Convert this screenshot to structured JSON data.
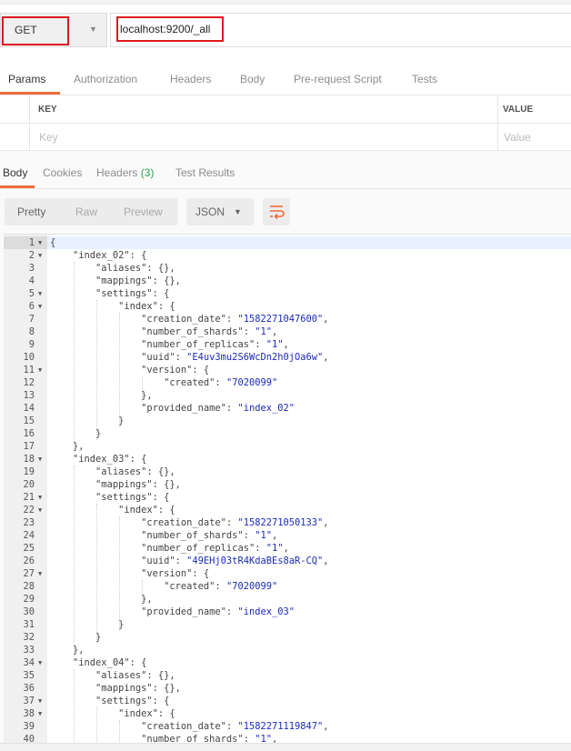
{
  "request": {
    "method": "GET",
    "url": "localhost:9200/_all"
  },
  "request_tabs": [
    "Params",
    "Authorization",
    "Headers",
    "Body",
    "Pre-request Script",
    "Tests"
  ],
  "params_table": {
    "key_header": "KEY",
    "value_header": "VALUE",
    "key_placeholder": "Key",
    "value_placeholder": "Value"
  },
  "response_tabs": {
    "body": "Body",
    "cookies": "Cookies",
    "headers": "Headers",
    "headers_count": "(3)",
    "test_results": "Test Results"
  },
  "toolbar": {
    "pretty": "Pretty",
    "raw": "Raw",
    "preview": "Preview",
    "format": "JSON"
  },
  "colors": {
    "accent": "#f26b3a",
    "highlight_box": "#e0191f",
    "json_string": "#1c2bb8",
    "headers_count": "#2ea44f"
  },
  "icons": {
    "method_dropdown": "chevron-down-icon",
    "format_dropdown": "chevron-down-icon",
    "wrap": "wrap-lines-icon",
    "fold": "fold-arrow-icon"
  },
  "code_lines": [
    {
      "n": "1",
      "fold": true,
      "text": "{"
    },
    {
      "n": "2",
      "fold": true,
      "text": "    \"index_02\": {"
    },
    {
      "n": "3",
      "fold": false,
      "text": "        \"aliases\": {},"
    },
    {
      "n": "4",
      "fold": false,
      "text": "        \"mappings\": {},"
    },
    {
      "n": "5",
      "fold": true,
      "text": "        \"settings\": {"
    },
    {
      "n": "6",
      "fold": true,
      "text": "            \"index\": {"
    },
    {
      "n": "7",
      "fold": false,
      "text": "                \"creation_date\": \"1582271047600\","
    },
    {
      "n": "8",
      "fold": false,
      "text": "                \"number_of_shards\": \"1\","
    },
    {
      "n": "9",
      "fold": false,
      "text": "                \"number_of_replicas\": \"1\","
    },
    {
      "n": "10",
      "fold": false,
      "text": "                \"uuid\": \"E4uv3mu2S6WcDn2h0jOa6w\","
    },
    {
      "n": "11",
      "fold": true,
      "text": "                \"version\": {"
    },
    {
      "n": "12",
      "fold": false,
      "text": "                    \"created\": \"7020099\""
    },
    {
      "n": "13",
      "fold": false,
      "text": "                },"
    },
    {
      "n": "14",
      "fold": false,
      "text": "                \"provided_name\": \"index_02\""
    },
    {
      "n": "15",
      "fold": false,
      "text": "            }"
    },
    {
      "n": "16",
      "fold": false,
      "text": "        }"
    },
    {
      "n": "17",
      "fold": false,
      "text": "    },"
    },
    {
      "n": "18",
      "fold": true,
      "text": "    \"index_03\": {"
    },
    {
      "n": "19",
      "fold": false,
      "text": "        \"aliases\": {},"
    },
    {
      "n": "20",
      "fold": false,
      "text": "        \"mappings\": {},"
    },
    {
      "n": "21",
      "fold": true,
      "text": "        \"settings\": {"
    },
    {
      "n": "22",
      "fold": true,
      "text": "            \"index\": {"
    },
    {
      "n": "23",
      "fold": false,
      "text": "                \"creation_date\": \"1582271050133\","
    },
    {
      "n": "24",
      "fold": false,
      "text": "                \"number_of_shards\": \"1\","
    },
    {
      "n": "25",
      "fold": false,
      "text": "                \"number_of_replicas\": \"1\","
    },
    {
      "n": "26",
      "fold": false,
      "text": "                \"uuid\": \"49EHj03tR4KdaBEs8aR-CQ\","
    },
    {
      "n": "27",
      "fold": true,
      "text": "                \"version\": {"
    },
    {
      "n": "28",
      "fold": false,
      "text": "                    \"created\": \"7020099\""
    },
    {
      "n": "29",
      "fold": false,
      "text": "                },"
    },
    {
      "n": "30",
      "fold": false,
      "text": "                \"provided_name\": \"index_03\""
    },
    {
      "n": "31",
      "fold": false,
      "text": "            }"
    },
    {
      "n": "32",
      "fold": false,
      "text": "        }"
    },
    {
      "n": "33",
      "fold": false,
      "text": "    },"
    },
    {
      "n": "34",
      "fold": true,
      "text": "    \"index_04\": {"
    },
    {
      "n": "35",
      "fold": false,
      "text": "        \"aliases\": {},"
    },
    {
      "n": "36",
      "fold": false,
      "text": "        \"mappings\": {},"
    },
    {
      "n": "37",
      "fold": true,
      "text": "        \"settings\": {"
    },
    {
      "n": "38",
      "fold": true,
      "text": "            \"index\": {"
    },
    {
      "n": "39",
      "fold": false,
      "text": "                \"creation_date\": \"1582271119847\","
    },
    {
      "n": "40",
      "fold": false,
      "text": "                \"number_of_shards\": \"1\","
    }
  ]
}
